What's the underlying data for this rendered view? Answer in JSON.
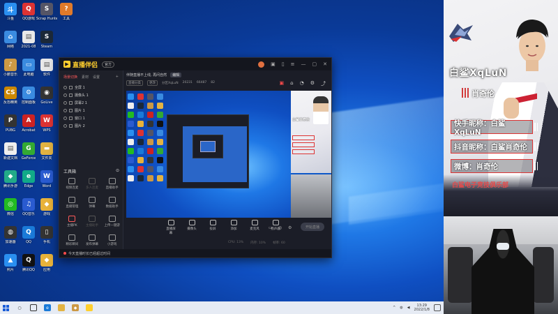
{
  "desktop": {
    "icons": [
      {
        "label": "斗鱼",
        "color": "#2a8ff0",
        "glyph": "斗"
      },
      {
        "label": "QQ游戏",
        "color": "#d33",
        "glyph": "Q"
      },
      {
        "label": "Scrap Hunter",
        "color": "#556",
        "glyph": "S"
      },
      {
        "label": "网络",
        "color": "#3a8be0",
        "glyph": "⌂"
      },
      {
        "label": "2021-08",
        "color": "#e8e8e8",
        "glyph": "▤"
      },
      {
        "label": "Steam",
        "color": "#1b2838",
        "glyph": "S"
      },
      {
        "label": "小鹏音乐",
        "color": "#c94",
        "glyph": "♪"
      },
      {
        "label": "此电脑",
        "color": "#3a8be0",
        "glyph": "▭"
      },
      {
        "label": "软件",
        "color": "#e8e8e8",
        "glyph": "▤"
      },
      {
        "label": "反恐精英",
        "color": "#c80",
        "glyph": "CS"
      },
      {
        "label": "控制面板",
        "color": "#3a8be0",
        "glyph": "⚙"
      },
      {
        "label": "GoLive",
        "color": "#333",
        "glyph": "◉"
      },
      {
        "label": "PUBG",
        "color": "#333",
        "glyph": "P"
      },
      {
        "label": "Acrobat",
        "color": "#c22",
        "glyph": "A"
      },
      {
        "label": "WPS",
        "color": "#d33",
        "glyph": "W"
      },
      {
        "label": "新建文档",
        "color": "#eee",
        "glyph": "▤"
      },
      {
        "label": "GeForce",
        "color": "#3a3",
        "glyph": "G"
      },
      {
        "label": "文件夹",
        "color": "#e3b342",
        "glyph": "▬"
      },
      {
        "label": "腾讯手游",
        "color": "#2a8",
        "glyph": "◆"
      },
      {
        "label": "Edge",
        "color": "#1a8",
        "glyph": "e"
      },
      {
        "label": "Word",
        "color": "#2a5bd0",
        "glyph": "W"
      },
      {
        "label": "微信",
        "color": "#2b2",
        "glyph": "◎"
      },
      {
        "label": "QQ音乐",
        "color": "#2a5bd0",
        "glyph": "♫"
      },
      {
        "label": "游戏",
        "color": "#e8b23a",
        "glyph": "◆"
      },
      {
        "label": "加速器",
        "color": "#333",
        "glyph": "◍"
      },
      {
        "label": "QQ",
        "color": "#1a7ad8",
        "glyph": "Q"
      },
      {
        "label": "手机",
        "color": "#333",
        "glyph": "▯"
      },
      {
        "label": "照片",
        "color": "#2a8ff0",
        "glyph": "▲"
      },
      {
        "label": "腾讯QQ",
        "color": "#111",
        "glyph": "Q"
      },
      {
        "label": "应用",
        "color": "#e8b23a",
        "glyph": "◆"
      },
      {
        "label": "工具",
        "color": "#e07a2a",
        "glyph": "?"
      }
    ]
  },
  "app": {
    "logo_text": "直播伴侣",
    "version_badge": "官方",
    "left_tabs": [
      "场景切换",
      "素材",
      "设置"
    ],
    "scenes": [
      "全屏 1",
      "摄像头 1",
      "屏幕2 1",
      "图片 1",
      "窗口 1",
      "图片 2"
    ],
    "toolbox_title": "工具箱",
    "tools": [
      {
        "label": "视频连麦",
        "state": "normal"
      },
      {
        "label": "多人连麦",
        "state": "dim"
      },
      {
        "label": "直播助手",
        "state": "normal"
      },
      {
        "label": "直播管理",
        "state": "normal"
      },
      {
        "label": "弹幕",
        "state": "normal"
      },
      {
        "label": "数据助手",
        "state": "normal"
      },
      {
        "label": "主播PK",
        "state": "hot"
      },
      {
        "label": "主播助手",
        "state": "dim"
      },
      {
        "label": "上传一键游",
        "state": "normal"
      },
      {
        "label": "精彩瞬间",
        "state": "normal"
      },
      {
        "label": "发布弹幕",
        "state": "normal"
      },
      {
        "label": "小游戏",
        "state": "normal"
      }
    ],
    "stream_title": "伴随直播不上线, 再问自然",
    "stream_tag": "编辑",
    "sub_items": [
      "直播分类",
      "更改",
      "分区XqLuN",
      "20231",
      "66487",
      "82"
    ],
    "controls": [
      "直播屏幕",
      "摄像头",
      "投屏",
      "添加",
      "麦克风",
      "扬声器"
    ],
    "live_button": "开始直播",
    "stats": [
      "CPU: 13%",
      "内存: 10%",
      "帧率: 60"
    ],
    "status_text": "今天直播时长已经超过时间"
  },
  "preview": {
    "name": "白鲨肖奇伦"
  },
  "taskbar": {
    "search_glyph": "○",
    "time": "13:29",
    "date": "2022/1/8"
  },
  "overlay": {
    "player_name": "白鲨XqLuN",
    "player_cn": "肖奇伦",
    "info": [
      "快手昵称：白鲨XqLuN",
      "抖音昵称：白鲨肖奇伦",
      "微博：肖奇伦"
    ],
    "club": "白鲨电子竞技俱乐部"
  },
  "colors": {
    "accent_red": "#d33333",
    "app_bg": "#1b1d27",
    "brand_yellow": "#ffcf2e"
  }
}
